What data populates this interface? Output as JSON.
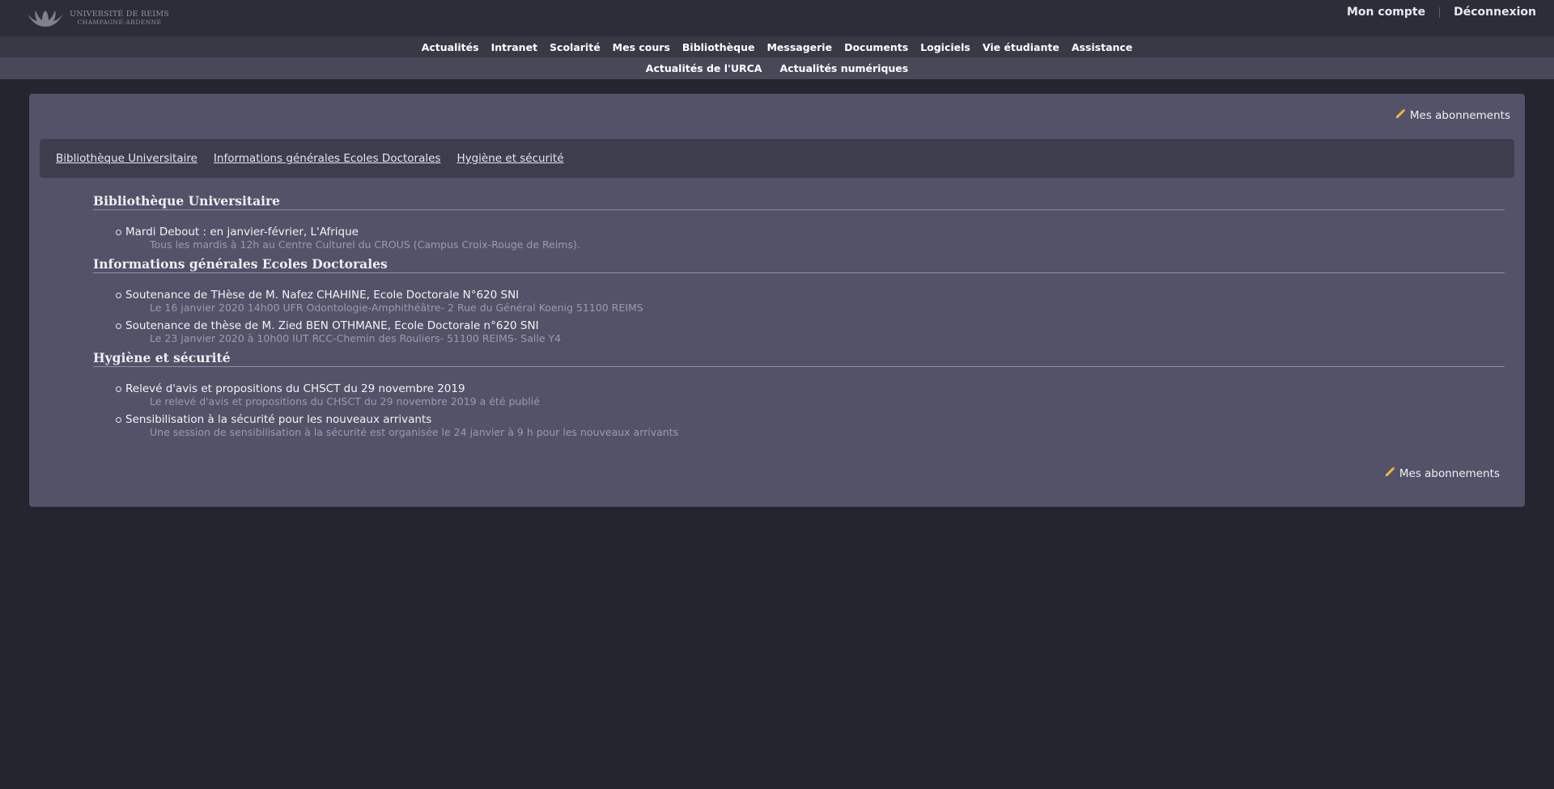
{
  "header": {
    "logo_line1": "UNIVERSITÉ DE REIMS",
    "logo_line2": "CHAMPAGNE-ARDENNE",
    "account_label": "Mon compte",
    "logout_label": "Déconnexion"
  },
  "nav_primary": [
    "Actualités",
    "Intranet",
    "Scolarité",
    "Mes cours",
    "Bibliothèque",
    "Messagerie",
    "Documents",
    "Logiciels",
    "Vie étudiante",
    "Assistance"
  ],
  "nav_secondary": [
    "Actualités de l'URCA",
    "Actualités numériques"
  ],
  "subscriptions_label": "Mes abonnements",
  "tabs": [
    "Bibliothèque Universitaire",
    "Informations générales Ecoles Doctorales",
    "Hygiène et sécurité"
  ],
  "sections": [
    {
      "title": "Bibliothèque Universitaire",
      "items": [
        {
          "title": "Mardi Debout : en janvier-février, L'Afrique",
          "desc": "Tous les mardis à 12h au Centre Culturel du CROUS (Campus Croix-Rouge de Reims)."
        }
      ]
    },
    {
      "title": "Informations générales Ecoles Doctorales",
      "items": [
        {
          "title": "Soutenance de THèse de M. Nafez CHAHINE, Ecole Doctorale N°620 SNI",
          "desc": "Le 16 janvier 2020 14h00 UFR Odontologie-Amphithéâtre- 2 Rue du Général Koenig 51100 REIMS"
        },
        {
          "title": "Soutenance de thèse de M. Zied BEN OTHMANE, Ecole Doctorale n°620 SNI",
          "desc": "Le 23 janvier 2020 à 10h00 IUT RCC-Chemin des Rouliers- 51100 REIMS- Salle Y4"
        }
      ]
    },
    {
      "title": "Hygiène et sécurité",
      "items": [
        {
          "title": "Relevé d'avis et propositions du CHSCT du 29 novembre 2019",
          "desc": "Le relevé d'avis et propositions du CHSCT du 29 novembre 2019 a été publié"
        },
        {
          "title": "Sensibilisation à la sécurité pour les nouveaux arrivants",
          "desc": "Une session de sensibilisation à la sécurité est organisée le 24 janvier à 9 h pour les nouveaux arrivants"
        }
      ]
    }
  ]
}
